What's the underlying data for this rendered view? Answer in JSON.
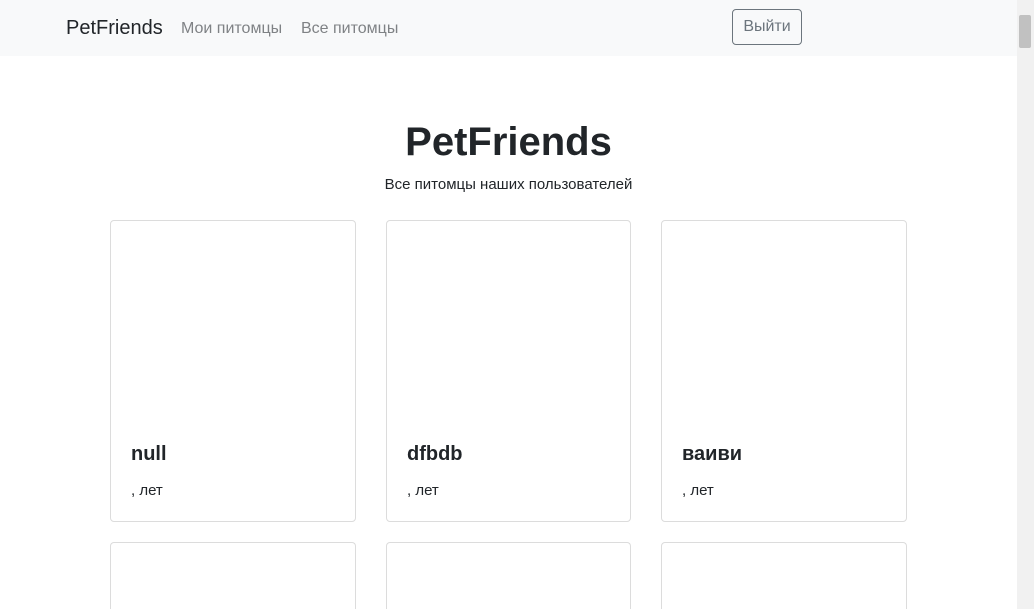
{
  "navbar": {
    "brand": "PetFriends",
    "links": [
      "Мои питомцы",
      "Все питомцы"
    ],
    "logout_label": "Выйти"
  },
  "main": {
    "title": "PetFriends",
    "subtitle": "Все питомцы наших пользователей"
  },
  "pets": [
    {
      "name": "null",
      "age_text": ", лет"
    },
    {
      "name": "dfbdb",
      "age_text": ", лет"
    },
    {
      "name": "ваиви",
      "age_text": ", лет"
    }
  ]
}
